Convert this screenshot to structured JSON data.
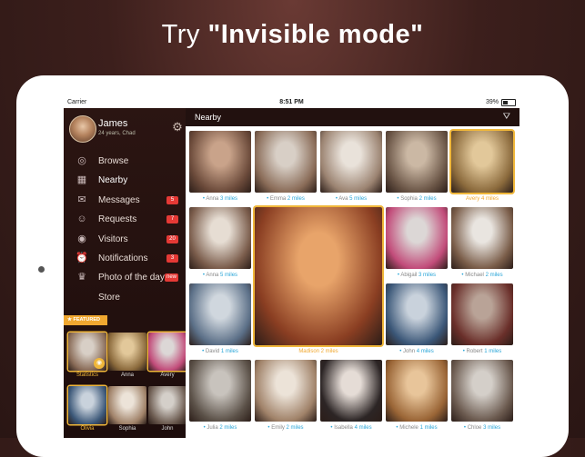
{
  "headline": {
    "prefix": "Try ",
    "bold": "\"Invisible mode\""
  },
  "status": {
    "carrier": "Carrier",
    "time": "8:51 PM",
    "battery": "39%"
  },
  "profile": {
    "name": "James",
    "sub": "24 years, Chad"
  },
  "menu": [
    {
      "label": "Browse",
      "icon": "person-circle-icon",
      "glyph": "◎",
      "badge": ""
    },
    {
      "label": "Nearby",
      "icon": "grid-icon",
      "glyph": "▦",
      "badge": ""
    },
    {
      "label": "Messages",
      "icon": "chat-icon",
      "glyph": "✉",
      "badge": "5"
    },
    {
      "label": "Requests",
      "icon": "add-user-icon",
      "glyph": "☺",
      "badge": "7"
    },
    {
      "label": "Visitors",
      "icon": "eye-icon",
      "glyph": "◉",
      "badge": "20"
    },
    {
      "label": "Notifications",
      "icon": "alarm-icon",
      "glyph": "⏰",
      "badge": "3"
    },
    {
      "label": "Photo of the day",
      "icon": "trophy-icon",
      "glyph": "♛",
      "badge": "new"
    },
    {
      "label": "Store",
      "icon": "",
      "glyph": "",
      "badge": ""
    }
  ],
  "featured": {
    "tag": "FEATURED",
    "items": [
      {
        "name": "Statistics"
      },
      {
        "name": "Anna"
      },
      {
        "name": "Avery"
      },
      {
        "name": "Olivia"
      },
      {
        "name": "Sophia"
      },
      {
        "name": "John"
      }
    ]
  },
  "main": {
    "title": "Nearby"
  },
  "people": [
    {
      "name": "Anna",
      "dist": "3 miles"
    },
    {
      "name": "Emma",
      "dist": "2 miles"
    },
    {
      "name": "Ava",
      "dist": "5 miles"
    },
    {
      "name": "Sophia",
      "dist": "2 miles"
    },
    {
      "name": "Avery",
      "dist": "4 miles"
    },
    {
      "name": "Anna",
      "dist": "5 miles"
    },
    {
      "name": "Madison",
      "dist": "2 miles"
    },
    {
      "name": "Abigail",
      "dist": "3 miles"
    },
    {
      "name": "Michael",
      "dist": "2 miles"
    },
    {
      "name": "David",
      "dist": "1 miles"
    },
    {
      "name": "John",
      "dist": "4 miles"
    },
    {
      "name": "Robert",
      "dist": "1 miles"
    },
    {
      "name": "Julia",
      "dist": "2 miles"
    },
    {
      "name": "Emily",
      "dist": "2 miles"
    },
    {
      "name": "Isabella",
      "dist": "4 miles"
    },
    {
      "name": "Michele",
      "dist": "1 miles"
    },
    {
      "name": "Chloe",
      "dist": "3 miles"
    }
  ],
  "colors": {
    "accent": "#f0a830",
    "distance": "#2aa6d8",
    "badge": "#e53935"
  }
}
